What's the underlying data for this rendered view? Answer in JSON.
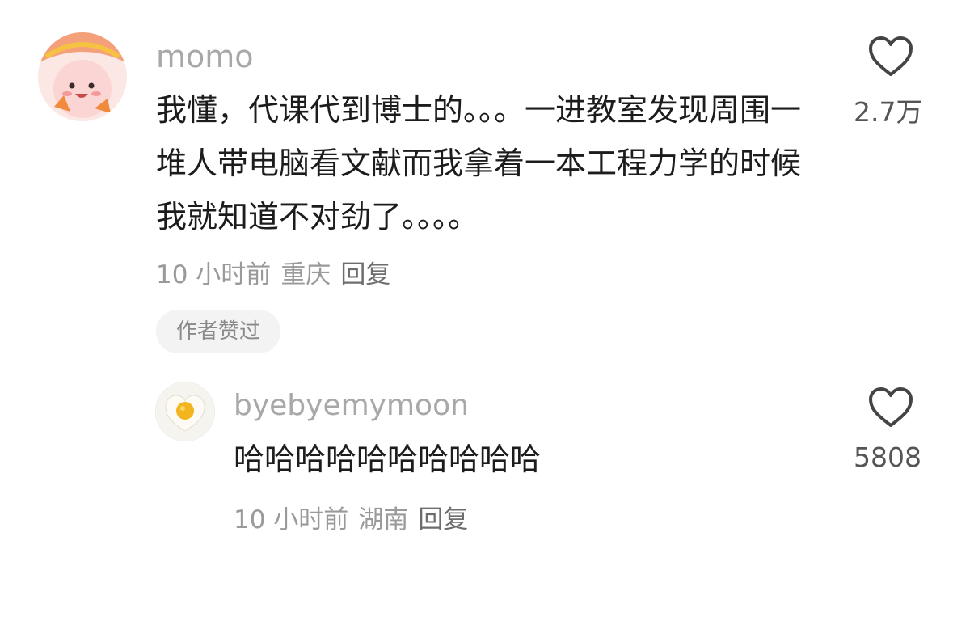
{
  "comments": [
    {
      "username": "momo",
      "text": "我懂，代课代到博士的。。。一进教室发现周围一堆人带电脑看文献而我拿着一本工程力学的时候我就知道不对劲了。。。。",
      "time": "10 小时前",
      "location": "重庆",
      "reply_label": "回复",
      "badge": "作者赞过",
      "like_count": "2.7万",
      "avatar_icon": "pink-bear-avatar-icon"
    },
    {
      "username": "byebyemymoon",
      "text": "哈哈哈哈哈哈哈哈哈哈",
      "time": "10 小时前",
      "location": "湖南",
      "reply_label": "回复",
      "like_count": "5808",
      "avatar_icon": "heart-egg-avatar-icon"
    }
  ],
  "colors": {
    "username": "#a8a8a8",
    "text": "#1c1c1c",
    "meta": "#9a9a9a",
    "badge_bg": "#f3f3f3",
    "heart_stroke": "#444444"
  }
}
